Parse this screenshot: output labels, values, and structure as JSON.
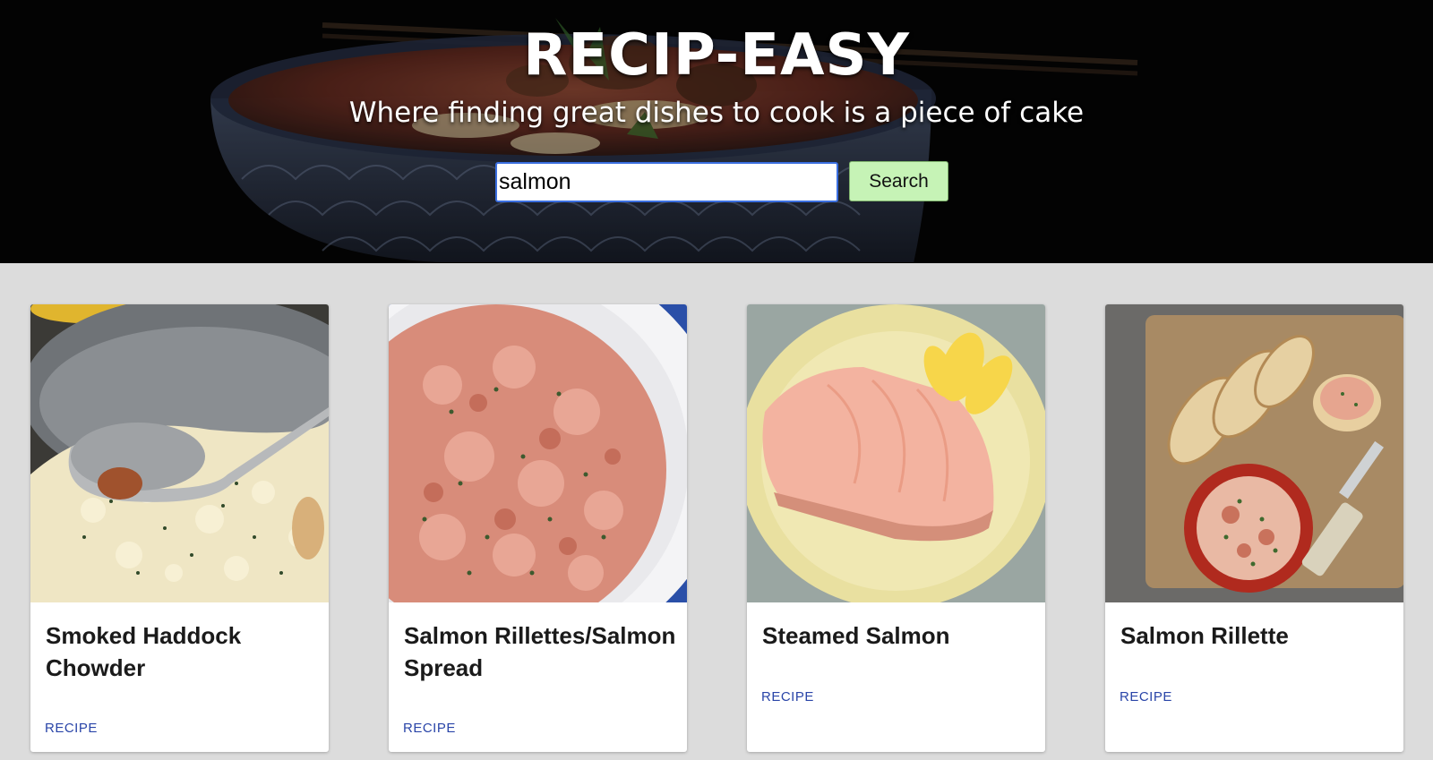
{
  "hero": {
    "title": "RECIP-EASY",
    "subtitle": "Where finding great dishes to cook is a piece of cake"
  },
  "search": {
    "value": "salmon",
    "button_label": "Search"
  },
  "colors": {
    "search_button_bg": "#c6f3b6",
    "link": "#2a45a8",
    "page_bg": "#dcdcdc",
    "input_border": "#3b6fe0"
  },
  "recipes": [
    {
      "title": "Smoked Haddock Chowder",
      "link_label": "RECIPE"
    },
    {
      "title": "Salmon Rillettes/Salmon Spread",
      "link_label": "RECIPE"
    },
    {
      "title": "Steamed Salmon",
      "link_label": "RECIPE"
    },
    {
      "title": "Salmon Rillette",
      "link_label": "RECIPE"
    }
  ]
}
